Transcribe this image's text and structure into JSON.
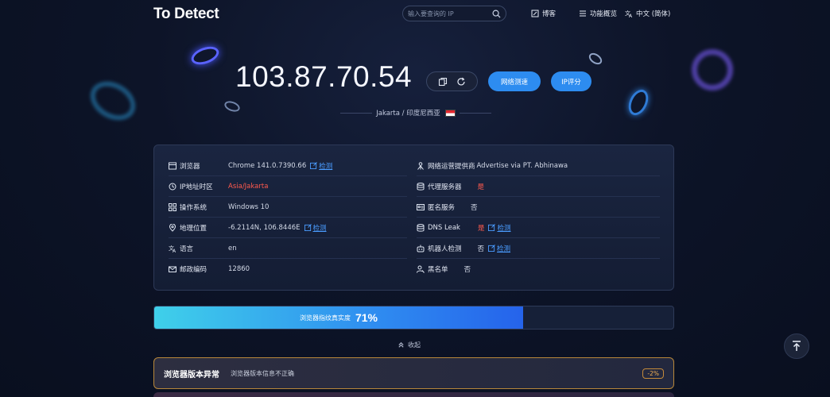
{
  "header": {
    "logo": "To Detect",
    "search_placeholder": "输入要查询的 IP",
    "nav": [
      {
        "label": "博客",
        "icon": "edit-icon"
      },
      {
        "label": "功能概览",
        "icon": "menu-icon"
      },
      {
        "label": "中文 (简体)",
        "icon": "translate-icon"
      }
    ]
  },
  "hero": {
    "ip": "103.87.70.54",
    "speed_button": "网络测速",
    "score_button": "IP评分",
    "location": "Jakarta / 印度尼西亚",
    "flag_colors": [
      "#e3262e",
      "#ffffff"
    ]
  },
  "info": {
    "left": [
      {
        "label": "浏览器",
        "value": "Chrome 141.0.7390.66",
        "check": "检测",
        "icon": "browser-icon"
      },
      {
        "label": "IP地址时区",
        "value": "Asia/Jakarta",
        "red": true,
        "icon": "location-pin-icon"
      },
      {
        "label": "操作系统",
        "value": "Windows 10",
        "icon": "grid-icon"
      },
      {
        "label": "地理位置",
        "value": "-6.2114N, 106.8446E",
        "check": "检测",
        "icon": "map-pin-icon"
      },
      {
        "label": "语言",
        "value": "en",
        "icon": "translate-icon"
      },
      {
        "label": "邮政编码",
        "value": "12860",
        "icon": "mail-icon"
      }
    ],
    "right": [
      {
        "label": "网络运营提供商",
        "value": "Advertise via PT. Abhinawa",
        "icon": "user-network-icon"
      },
      {
        "label": "代理服务器",
        "value": "是",
        "red": true,
        "icon": "database-icon"
      },
      {
        "label": "匿名服务",
        "value": "否",
        "icon": "id-card-icon"
      },
      {
        "label": "DNS Leak",
        "value": "是",
        "red": true,
        "check": "检测",
        "icon": "database-icon"
      },
      {
        "label": "机器人检测",
        "value": "否",
        "check": "检测",
        "icon": "robot-icon"
      },
      {
        "label": "黑名单",
        "value": "否",
        "icon": "user-block-icon"
      }
    ]
  },
  "progress": {
    "label": "浏览器指纹真实度",
    "percent_text": "71%",
    "value": 0.71
  },
  "collapse_label": "收起",
  "anomaly": {
    "title": "浏览器版本异常",
    "desc": "浏览器版本信息不正确",
    "badge": "-2%"
  },
  "colors": {
    "accent": "#2d8cf0",
    "danger": "#ff5a4d",
    "warning": "#f4b154"
  }
}
